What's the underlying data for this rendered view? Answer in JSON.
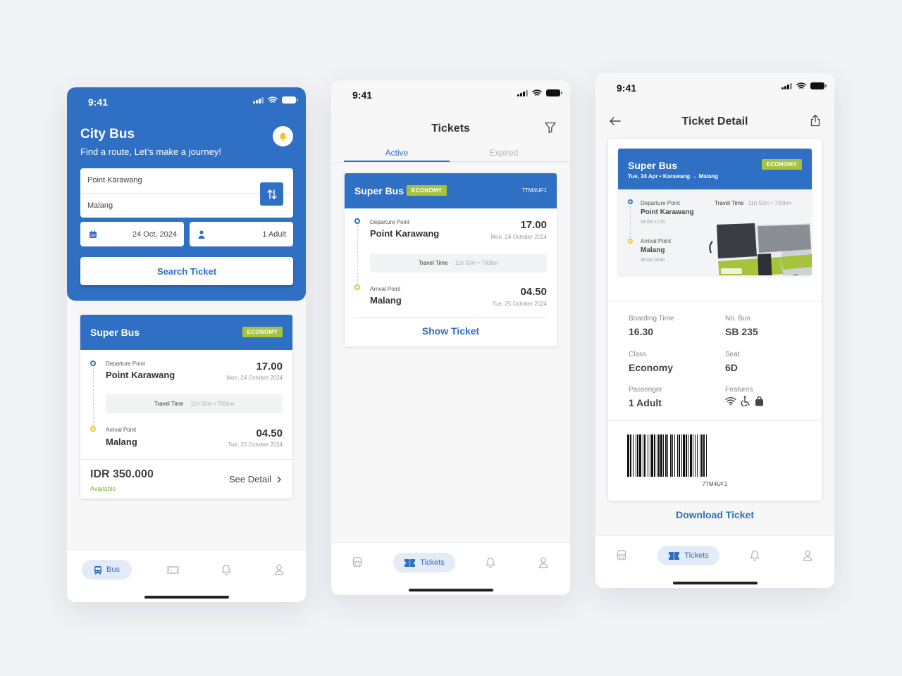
{
  "status": {
    "time": "9:41"
  },
  "home": {
    "title": "City Bus",
    "subtitle": "Find a route, Let’s make a journey!",
    "from": "Point Karawang",
    "to": "Malang",
    "date": "24 Oct, 2024",
    "passengers": "1 Adult",
    "search_label": "Search Ticket",
    "card": {
      "bus_name": "Super Bus",
      "class_badge": "ECONOMY",
      "departure_label": "Departure Point",
      "departure_place": "Point Karawang",
      "departure_time": "17.00",
      "departure_date": "Mon, 24 October 2024",
      "travel_label": "Travel Time",
      "travel_info": "11h 50m • 793km",
      "arrival_label": "Arrival Point",
      "arrival_place": "Malang",
      "arrival_time": "04.50",
      "arrival_date": "Tue, 25 October 2024",
      "price": "IDR 350.000",
      "availability": "Available",
      "detail_link": "See Detail"
    },
    "nav": {
      "bus": "Bus"
    }
  },
  "tickets": {
    "title": "Tickets",
    "tabs": [
      "Active",
      "Expired"
    ],
    "card": {
      "bus_name": "Super Bus",
      "class_badge": "ECONOMY",
      "code": "7TM4UF1",
      "departure_label": "Departure Point",
      "departure_place": "Point Karawang",
      "departure_time": "17.00",
      "departure_date": "Mon, 24 October 2024",
      "travel_label": "Travel Time",
      "travel_info": "11h 50m • 793km",
      "arrival_label": "Arrival Point",
      "arrival_place": "Malang",
      "arrival_time": "04.50",
      "arrival_date": "Tue, 25 October 2024",
      "show_label": "Show Ticket"
    },
    "nav": {
      "tickets": "Tickets"
    }
  },
  "detail": {
    "title": "Ticket Detail",
    "bus_name": "Super Bus",
    "class_badge": "ECONOMY",
    "route_line": "Tue, 24 Apr  •  Karawang  →  Malang",
    "departure_label": "Departure Point",
    "departure_place": "Point Karawang",
    "departure_meta": "24 Oct   17.00",
    "arrival_label": "Arrival Point",
    "arrival_place": "Malang",
    "arrival_meta": "25 Oct   04.50",
    "travel_label": "Travel Time",
    "travel_info": "11h 50m • 793km",
    "boarding_label": "Boarding Time",
    "boarding_value": "16.30",
    "bus_no_label": "No. Bus",
    "bus_no_value": "SB 235",
    "class_label": "Class",
    "class_value": "Economy",
    "seat_label": "Seat",
    "seat_value": "6D",
    "passenger_label": "Passenger",
    "passenger_value": "1 Adult",
    "features_label": "Features",
    "features": [
      "wifi-icon",
      "wheelchair-icon",
      "bag-icon"
    ],
    "barcode_code": "7TM4UF1",
    "download_label": "Download Ticket",
    "nav": {
      "tickets": "Tickets"
    }
  },
  "colors": {
    "primary": "#2f6fc4",
    "accent_green": "#a5c43c",
    "available_green": "#7cb82f",
    "arrival_yellow": "#f0c419"
  }
}
